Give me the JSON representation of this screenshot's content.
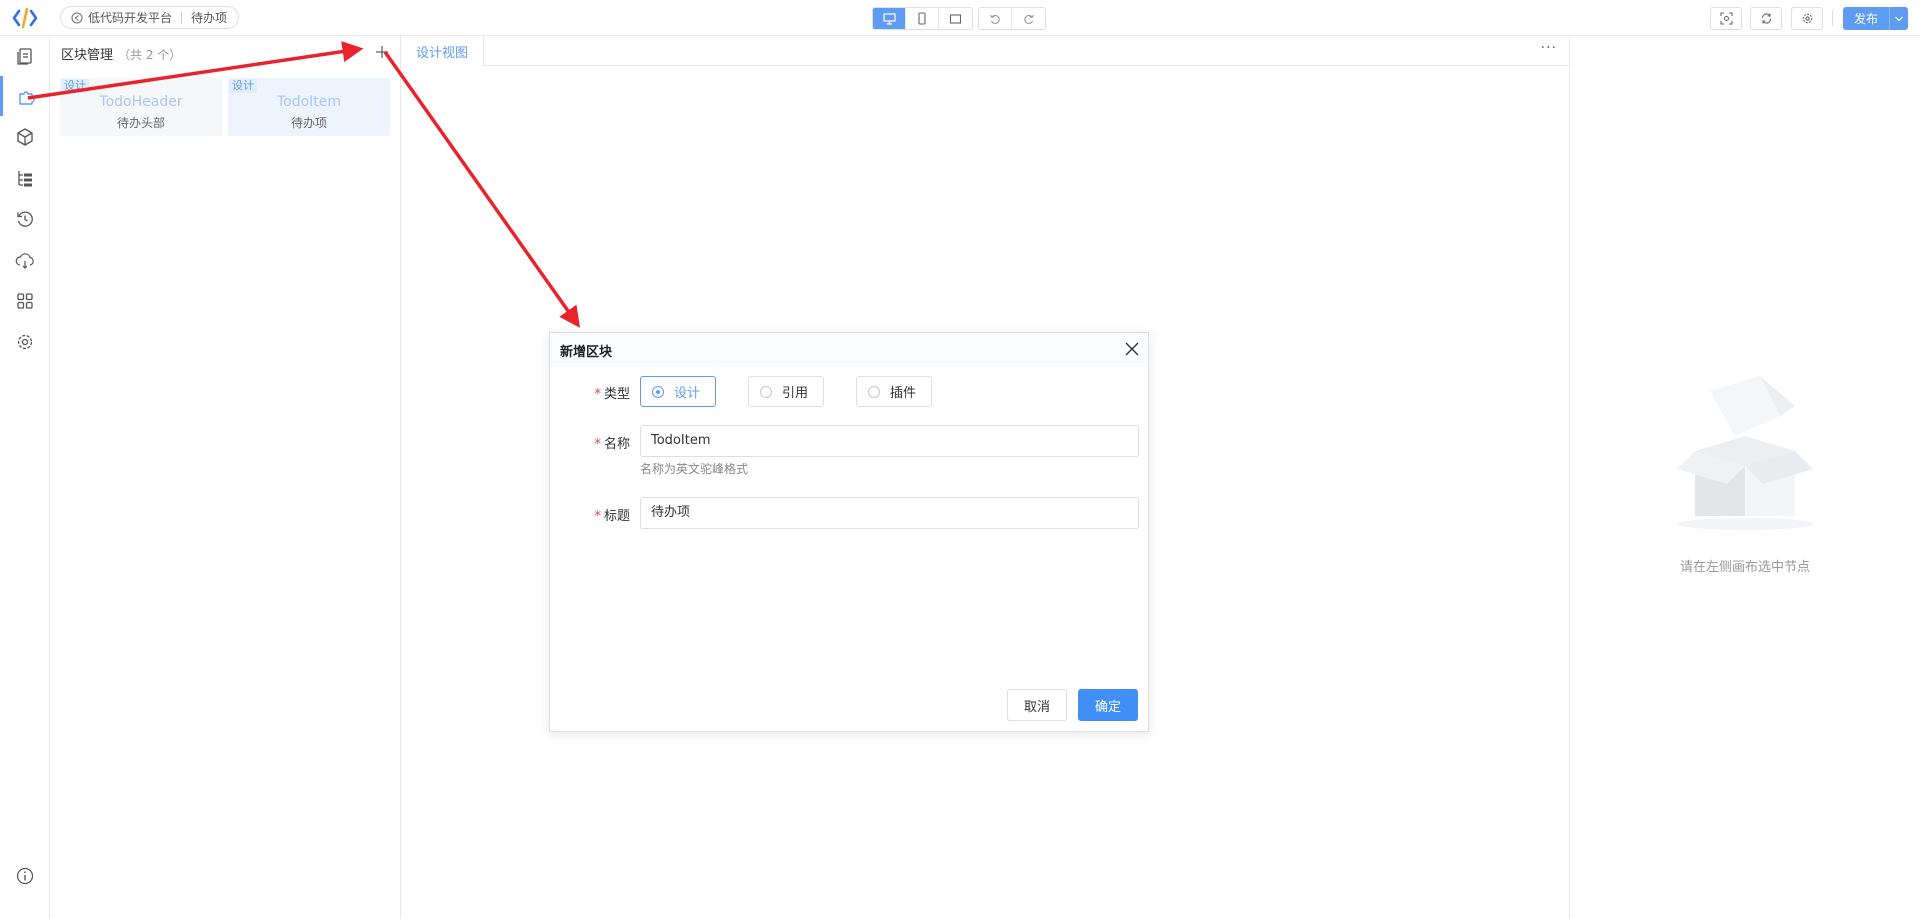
{
  "header": {
    "breadcrumb_platform": "低代码开发平台",
    "breadcrumb_page": "待办项",
    "publish_label": "发布"
  },
  "block_panel": {
    "title": "区块管理",
    "count": "（共 2 个）",
    "blocks": [
      {
        "tag": "设计",
        "name": "TodoHeader",
        "title": "待办头部"
      },
      {
        "tag": "设计",
        "name": "TodoItem",
        "title": "待办项"
      }
    ]
  },
  "canvas": {
    "tab_label": "设计视图",
    "more_label": "···"
  },
  "props_panel": {
    "empty_text": "请在左侧画布选中节点"
  },
  "dialog": {
    "title": "新增区块",
    "type_label": "类型",
    "type_options": [
      "设计",
      "引用",
      "插件"
    ],
    "type_selected": "设计",
    "name_label": "名称",
    "name_value": "TodoItem",
    "name_hint": "名称为英文驼峰格式",
    "title_label": "标题",
    "title_value": "待办项",
    "cancel_label": "取消",
    "confirm_label": "确定",
    "required_mark": "*"
  },
  "colors": {
    "accent": "#5e9cf2",
    "primary_button": "#3f8ff7",
    "annotation_arrow": "#e8232b"
  }
}
